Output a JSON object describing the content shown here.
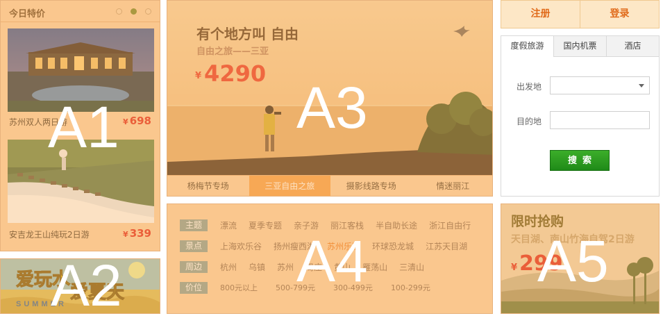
{
  "overlay_labels": {
    "a1": "A1",
    "a2": "A2",
    "a3": "A3",
    "a4": "A4",
    "a5": "A5"
  },
  "deals": {
    "title": "今日特价",
    "currency": "¥",
    "items": [
      {
        "name": "苏州双人两日游",
        "price": "698"
      },
      {
        "name": "安吉龙王山纯玩2日游",
        "price": "339"
      }
    ]
  },
  "promo_banner": {
    "line1": "爱玩水",
    "line2": "爱夏天",
    "sub": "SUMMER"
  },
  "hero": {
    "headline": "有个地方叫  自由",
    "subhead": "自由之旅——三亚",
    "currency": "¥",
    "price": "4290",
    "tabs": [
      {
        "label": "杨梅节专场"
      },
      {
        "label": "三亚自由之旅"
      },
      {
        "label": "摄影线路专场"
      },
      {
        "label": "情迷丽江"
      }
    ]
  },
  "auth": {
    "register": "注册",
    "login": "登录"
  },
  "search": {
    "tabs": [
      {
        "label": "度假旅游"
      },
      {
        "label": "国内机票"
      },
      {
        "label": "酒店"
      }
    ],
    "from_label": "出发地",
    "to_label": "目的地",
    "from_value": "",
    "to_value": "",
    "button": "搜索"
  },
  "filters": {
    "rows": [
      {
        "tag": "主题",
        "items": [
          "漂流",
          "夏季专题",
          "亲子游",
          "丽江客栈",
          "半自助长途",
          "浙江自由行"
        ]
      },
      {
        "tag": "景点",
        "items": [
          "上海欢乐谷",
          "扬州瘦西湖",
          "苏州乐园",
          "环球恐龙城",
          "江苏天目湖"
        ]
      },
      {
        "tag": "周边",
        "items": [
          "杭州",
          "乌镇",
          "苏州",
          "周庄",
          "黄山",
          "雁荡山",
          "三清山"
        ]
      },
      {
        "tag": "价位",
        "items": [
          "800元以上",
          "500-799元",
          "300-499元",
          "100-299元"
        ]
      }
    ]
  },
  "flash_sale": {
    "title": "限时抢购",
    "subtitle": "天目湖、南山竹海自驾2日游",
    "currency": "¥",
    "price": "299"
  },
  "colors": {
    "accent_orange": "#f6a24c",
    "price_red": "#e02a20",
    "search_green": "#2a9a20",
    "panel_peach": "#fbd3a8"
  }
}
